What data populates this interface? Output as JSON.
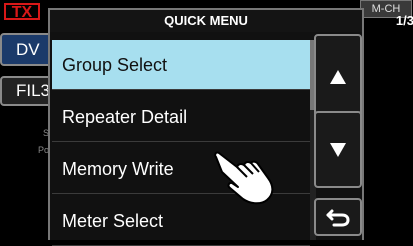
{
  "tx_label": "TX",
  "mch_label": "M-CH",
  "side": {
    "dv": "DV",
    "fil": "FIL3",
    "s_label": "S",
    "po_label": "Po"
  },
  "menu": {
    "title": "QUICK MENU",
    "page": "1/3",
    "items": [
      {
        "label": "Group Select",
        "selected": true
      },
      {
        "label": "Repeater Detail"
      },
      {
        "label": "Memory Write"
      },
      {
        "label": "Meter Select"
      }
    ],
    "scroll_fraction": 0.33
  },
  "buttons": {
    "up_icon": "triangle-up-icon",
    "down_icon": "triangle-down-icon",
    "back_icon": "return-icon"
  },
  "colors": {
    "selected": "#a7dfef",
    "tx": "#d81818"
  }
}
